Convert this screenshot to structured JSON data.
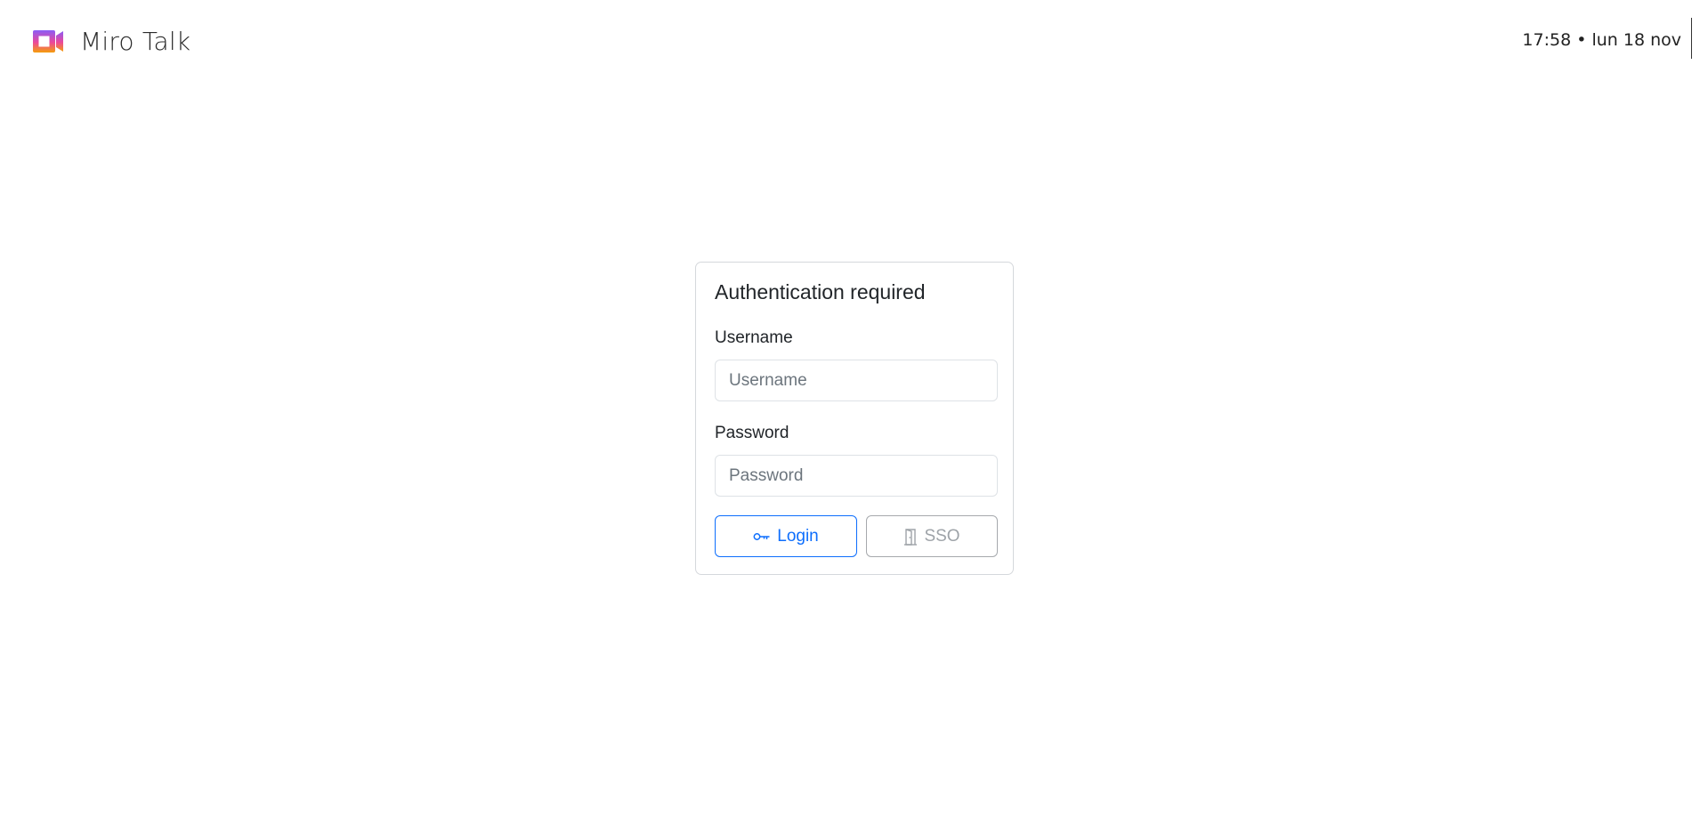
{
  "brand": {
    "name": "Miro Talk",
    "logo_icon": "video-camera-gradient-icon"
  },
  "clock": {
    "text": "17:58 • lun 18 nov"
  },
  "auth_card": {
    "title": "Authentication required",
    "username": {
      "label": "Username",
      "placeholder": "Username",
      "value": ""
    },
    "password": {
      "label": "Password",
      "placeholder": "Password",
      "value": ""
    },
    "login_button": {
      "label": "Login",
      "icon": "key-icon"
    },
    "sso_button": {
      "label": "SSO",
      "icon": "door-icon"
    }
  },
  "colors": {
    "primary": "#0d6efd",
    "disabled": "#9ea3a8",
    "border": "#d5d8dc",
    "logo_gradient": [
      "#8b5cf6",
      "#ec4899",
      "#f59e0b"
    ]
  }
}
